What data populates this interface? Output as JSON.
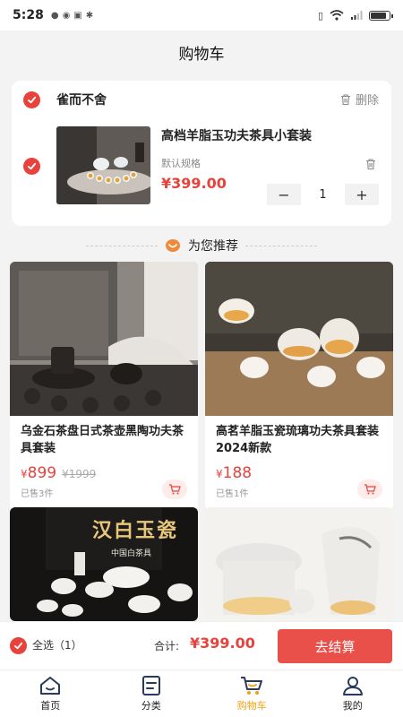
{
  "status_bar": {
    "time": "5:28"
  },
  "header": {
    "title": "购物车"
  },
  "cart": {
    "shop_name": "雀而不舍",
    "delete_label": "删除",
    "item": {
      "title": "高档羊脂玉功夫茶具小套装",
      "spec": "默认规格",
      "price": "¥399.00",
      "quantity": "1"
    }
  },
  "recommend": {
    "title": "为您推荐",
    "products": [
      {
        "title": "乌金石茶盘日式茶壶黑陶功夫茶具套装",
        "currency": "¥",
        "price": "899",
        "orig_price": "¥1999",
        "sold": "已售3件"
      },
      {
        "title": "高茗羊脂玉瓷琉璃功夫茶具套装2024新款",
        "currency": "¥",
        "price": "188",
        "orig_price": "",
        "sold": "已售1件"
      },
      {
        "title": "",
        "image_text": "汉白玉瓷",
        "image_subtext": "中国白茶具"
      },
      {
        "title": ""
      }
    ]
  },
  "checkout": {
    "select_all_label": "全选（1）",
    "total_label": "合计:",
    "total_value": "¥399.00",
    "button_label": "去结算"
  },
  "tabs": [
    {
      "label": "首页",
      "icon": "home-icon"
    },
    {
      "label": "分类",
      "icon": "category-icon"
    },
    {
      "label": "购物车",
      "icon": "cart-icon",
      "active": true
    },
    {
      "label": "我的",
      "icon": "profile-icon"
    }
  ],
  "colors": {
    "accent": "#e8423c",
    "tab_active": "#f0a214"
  }
}
